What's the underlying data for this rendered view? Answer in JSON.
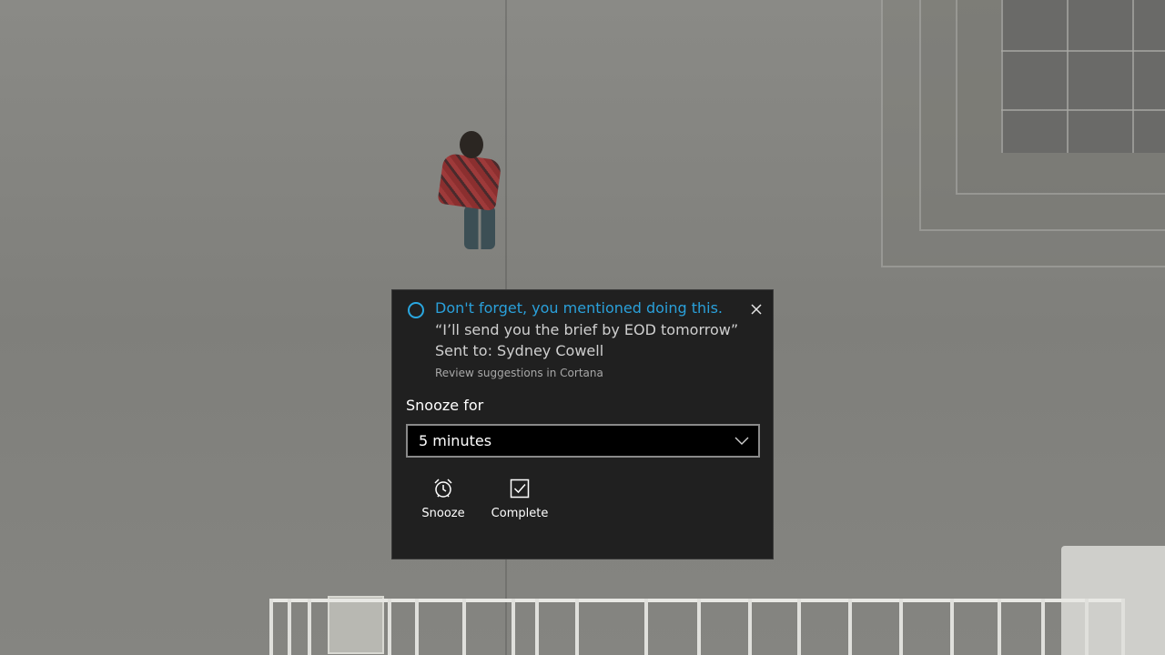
{
  "toast": {
    "app_icon": "cortana-ring-icon",
    "title": "Don't forget, you mentioned doing this.",
    "quote": "“I’ll send you the brief by EOD tomorrow”",
    "sent_to": "Sent to: Sydney Cowell",
    "attribution": "Review suggestions in Cortana",
    "close_icon": "close-icon",
    "snooze_label": "Snooze for",
    "snooze_selected": "5 minutes",
    "actions": [
      {
        "label": "Snooze",
        "icon": "alarm-clock-icon"
      },
      {
        "label": "Complete",
        "icon": "checkbox-checked-icon"
      }
    ],
    "colors": {
      "accent": "#2aa0da",
      "background": "#202020"
    }
  }
}
